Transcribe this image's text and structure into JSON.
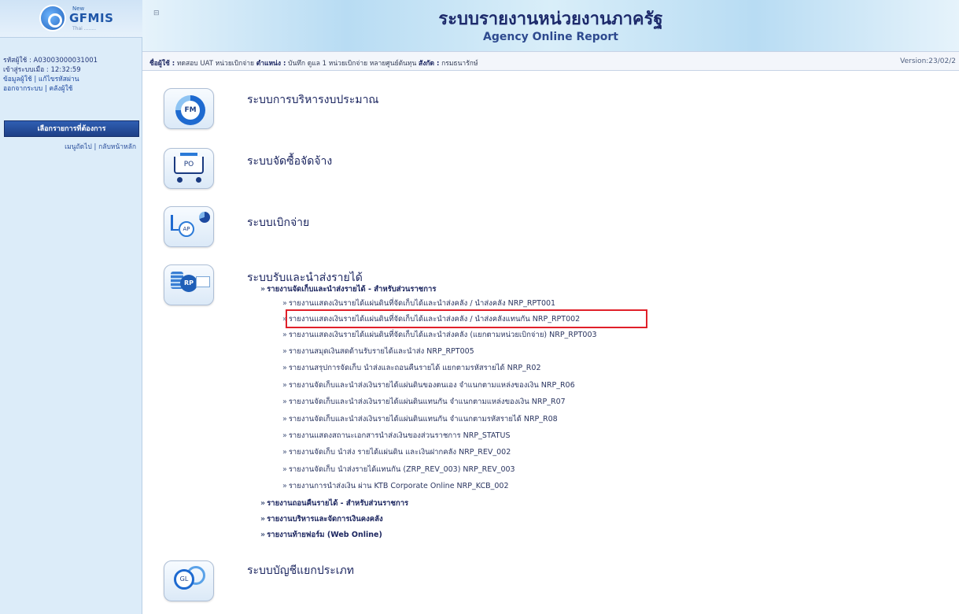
{
  "sidebar": {
    "logo": {
      "new": "New",
      "name": "GFMIS",
      "sub": "Thai ........"
    },
    "user_code": "รหัสผู้ใช้ : A03003000031001",
    "login_time": "เข้าสู่ระบบเมื่อ : 12:32:59",
    "user_links": [
      "ข้อมูลผู้ใช้ | แก้ไขรหัสผ่าน",
      "ออกจากระบบ | คลังผู้ใช้"
    ],
    "menu_button": "เลือกรายการที่ต้องการ",
    "nav_links": "เมนูถัดไป | กลับหน้าหลัก"
  },
  "header": {
    "collapse_label": "⊟",
    "title_th": "ระบบรายงานหน่วยงานภาครัฐ",
    "title_en": "Agency Online Report"
  },
  "infobar": {
    "user_label": "ชื่อผู้ใช้ :",
    "user_value": "ทดสอบ UAT หน่วยเบิกจ่าย",
    "position_label": "ตำแหน่ง :",
    "position_value": "บันทึก ดูแล 1 หน่วยเบิกจ่าย หลายศูนย์ต้นทุน",
    "affiliation_label": "สังกัด :",
    "affiliation_value": "กรมธนารักษ์",
    "version": "Version:23/02/2"
  },
  "modules": [
    {
      "icon": "FM",
      "title": "ระบบการบริหารงบประมาณ"
    },
    {
      "icon": "PO",
      "title": "ระบบจัดซื้อจัดจ้าง"
    },
    {
      "icon": "AP",
      "title": "ระบบเบิกจ่าย"
    },
    {
      "icon": "RP",
      "title": "ระบบรับและนำส่งรายได้"
    },
    {
      "icon": "GL",
      "title": "ระบบบัญชีแยกประเภท"
    }
  ],
  "revenue_tree": {
    "group1": "รายงานจัดเก็บและนำส่งรายได้ - สำหรับส่วนราชการ",
    "reports": [
      "รายงานแสดงเงินรายได้แผ่นดินที่จัดเก็บได้และนำส่งคลัง / นำส่งคลัง NRP_RPT001",
      "รายงานแสดงเงินรายได้แผ่นดินที่จัดเก็บได้และนำส่งคลัง / นำส่งคลังแทนกัน NRP_RPT002",
      "รายงานแสดงเงินรายได้แผ่นดินที่จัดเก็บได้และนำส่งคลัง (แยกตามหน่วยเบิกจ่าย) NRP_RPT003",
      "รายงานสมุดเงินสดด้านรับรายได้และนำส่ง NRP_RPT005",
      "รายงานสรุปการจัดเก็บ นำส่งและถอนคืนรายได้ แยกตามรหัสรายได้ NRP_R02",
      "รายงานจัดเก็บและนำส่งเงินรายได้แผ่นดินของตนเอง จำแนกตามแหล่งของเงิน NRP_R06",
      "รายงานจัดเก็บและนำส่งเงินรายได้แผ่นดินแทนกัน จำแนกตามแหล่งของเงิน NRP_R07",
      "รายงานจัดเก็บและนำส่งเงินรายได้แผ่นดินแทนกัน จำแนกตามรหัสรายได้ NRP_R08",
      "รายงานแสดงสถานะเอกสารนำส่งเงินของส่วนราชการ NRP_STATUS",
      "รายงานจัดเก็บ นำส่ง รายได้แผ่นดิน และเงินฝากคลัง NRP_REV_002",
      "รายงานจัดเก็บ นำส่งรายได้แทนกัน (ZRP_REV_003) NRP_REV_003",
      "รายงานการนำส่งเงิน ผ่าน KTB Corporate Online NRP_KCB_002"
    ],
    "group2": "รายงานถอนคืนรายได้ - สำหรับส่วนราชการ",
    "group3": "รายงานบริหารและจัดการเงินคงคลัง",
    "group4": "รายงานท้ายฟอร์ม (Web Online)"
  },
  "bullet": "»"
}
